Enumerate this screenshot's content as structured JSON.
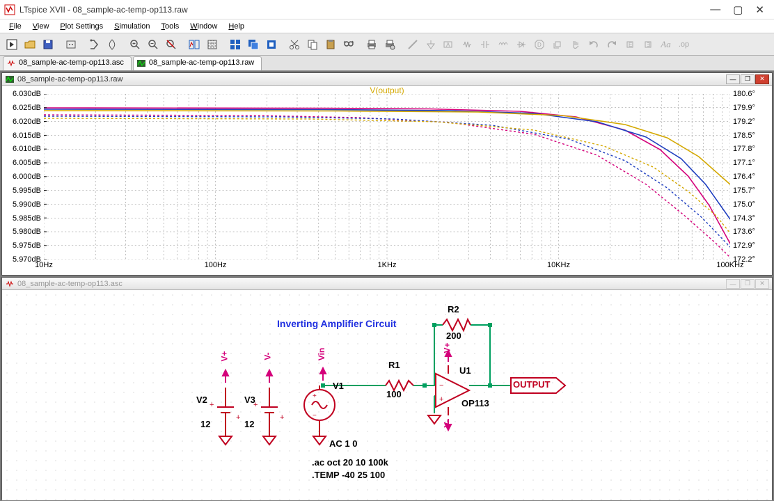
{
  "window": {
    "title": "LTspice XVII - 08_sample-ac-temp-op113.raw"
  },
  "menus": [
    "File",
    "View",
    "Plot Settings",
    "Simulation",
    "Tools",
    "Window",
    "Help"
  ],
  "tabs": [
    {
      "label": "08_sample-ac-temp-op113.asc",
      "icon": "schematic",
      "active": false
    },
    {
      "label": "08_sample-ac-temp-op113.raw",
      "icon": "waveform",
      "active": true
    }
  ],
  "panel_raw": {
    "title": "08_sample-ac-temp-op113.raw"
  },
  "panel_asc": {
    "title": "08_sample-ac-temp-op113.asc"
  },
  "plot": {
    "trace_label": "V(output)",
    "y_left": [
      "6.030dB",
      "6.025dB",
      "6.020dB",
      "6.015dB",
      "6.010dB",
      "6.005dB",
      "6.000dB",
      "5.995dB",
      "5.990dB",
      "5.985dB",
      "5.980dB",
      "5.975dB",
      "5.970dB"
    ],
    "y_right": [
      "180.6°",
      "179.9°",
      "179.2°",
      "178.5°",
      "177.8°",
      "177.1°",
      "176.4°",
      "175.7°",
      "175.0°",
      "174.3°",
      "173.6°",
      "172.9°",
      "172.2°"
    ],
    "x": [
      "10Hz",
      "100Hz",
      "1KHz",
      "10KHz",
      "100KHz"
    ]
  },
  "schematic": {
    "title": "Inverting Amplifier Circuit",
    "V2": {
      "name": "V2",
      "val": "12"
    },
    "V3": {
      "name": "V3",
      "val": "12"
    },
    "V1": {
      "name": "V1"
    },
    "R1": {
      "name": "R1",
      "val": "100"
    },
    "R2": {
      "name": "R2",
      "val": "200"
    },
    "U1": {
      "name": "U1",
      "model": "OP113"
    },
    "out_flag": "OUTPUT",
    "net": {
      "vp": "V+",
      "vm": "V-",
      "vin": "Vin"
    },
    "spice": [
      "AC 1 0",
      ".ac oct 20 10 100k",
      ".TEMP -40 25 100"
    ]
  }
}
